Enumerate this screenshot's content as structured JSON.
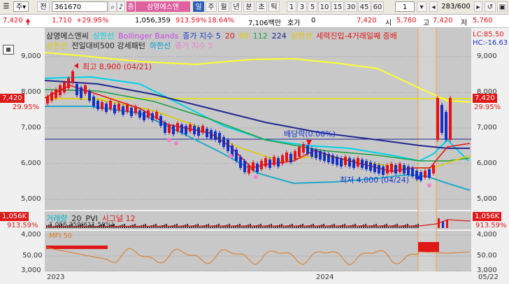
{
  "toolbar": {
    "type_label": "주",
    "jeon_label": "전",
    "code": "361670",
    "company_badge": "종",
    "company_name": "삼영에스앤",
    "periods": [
      "일",
      "주",
      "월",
      "년",
      "분",
      "초",
      "틱"
    ],
    "active_period": "일",
    "intervals": [
      "1",
      "3",
      "5",
      "10",
      "15",
      "30",
      "45",
      "60"
    ],
    "interval_value": "1",
    "count_display": "283/600"
  },
  "quote": {
    "price": "7,420",
    "change": "1,710",
    "change_pct": "+29.95%",
    "volume": "1,056,359",
    "volume_ratio": "913.59%",
    "turnover_rate": "18.64%",
    "amount": "7,106백만",
    "hoga_label": "호가",
    "hoga_value": "0",
    "current": "7,420",
    "open_label": "시",
    "open": "5,760",
    "high_label": "고",
    "high": "7,420",
    "low_label": "저",
    "low": "5,760"
  },
  "legend": {
    "line1": [
      {
        "text": "삼영에스앤씨",
        "color": "#222222"
      },
      {
        "text": "상한선",
        "color": "#00d2e6"
      },
      {
        "text": "Bollinger Bands",
        "color": "#c848e0"
      },
      {
        "text": "종가 지수 5",
        "color": "#1a3cc8"
      },
      {
        "text": "20",
        "color": "#e01818"
      },
      {
        "text": "60",
        "color": "#e0c800"
      },
      {
        "text": "112",
        "color": "#20a040"
      },
      {
        "text": "224",
        "color": "#202890"
      },
      {
        "text": "상한선",
        "color": "#e0c800"
      },
      {
        "text": "세력진입-4거래일째 증배",
        "color": "#e01818"
      }
    ],
    "line2": [
      {
        "text": "상한선",
        "color": "#e0c800"
      },
      {
        "text": "전일대비500 강세패턴",
        "color": "#222222"
      },
      {
        "text": "하한선",
        "color": "#00a0c8"
      },
      {
        "text": "종가 지수 5",
        "color": "#f080d0"
      }
    ],
    "right_lc": "LC:85.50",
    "right_hc": "HC:-16.63"
  },
  "annotations": {
    "high_note": "최고 8,900 (04/21)",
    "low_note": "최저 4,000 (04/24)",
    "dividend_note": "배당락(0.00%)"
  },
  "price_axis": {
    "ticks": [
      "9,000",
      "8,000",
      "7,000",
      "6,000",
      "5,000",
      "4,000",
      "3,000"
    ],
    "current_tag": "7,420",
    "pct_tag": "29.95%"
  },
  "volume_panel": {
    "legend": [
      {
        "text": "거래량",
        "color": "#00b4c8"
      },
      {
        "text": "20",
        "color": "#222222"
      },
      {
        "text": "PVI",
        "color": "#222222"
      },
      {
        "text": "시그널 12",
        "color": "#e01818"
      }
    ],
    "sub_text": "1,056,359(611.59%)",
    "left_tag": "1,056K",
    "left_pct": "913.59%",
    "right_tag": "1,056K",
    "right_pct": "913.59%"
  },
  "mfi_panel": {
    "label": "MFI 50",
    "tick": "50.00"
  },
  "time_axis": {
    "labels": [
      "2023",
      "2024",
      "05/22"
    ]
  },
  "colors": {
    "up": "#e8101a",
    "down": "#1430c8",
    "plot_bg": "#c8c8c8",
    "ma5": "#1a3cc8",
    "ma20": "#e01818",
    "ma60": "#e0c800",
    "ma112": "#20a040",
    "ma224": "#202890",
    "bb_upper": "#00d2e6",
    "bb_lower": "#20a8c8",
    "envelope_upper": "#ffff30",
    "mfi": "#e07820"
  }
}
